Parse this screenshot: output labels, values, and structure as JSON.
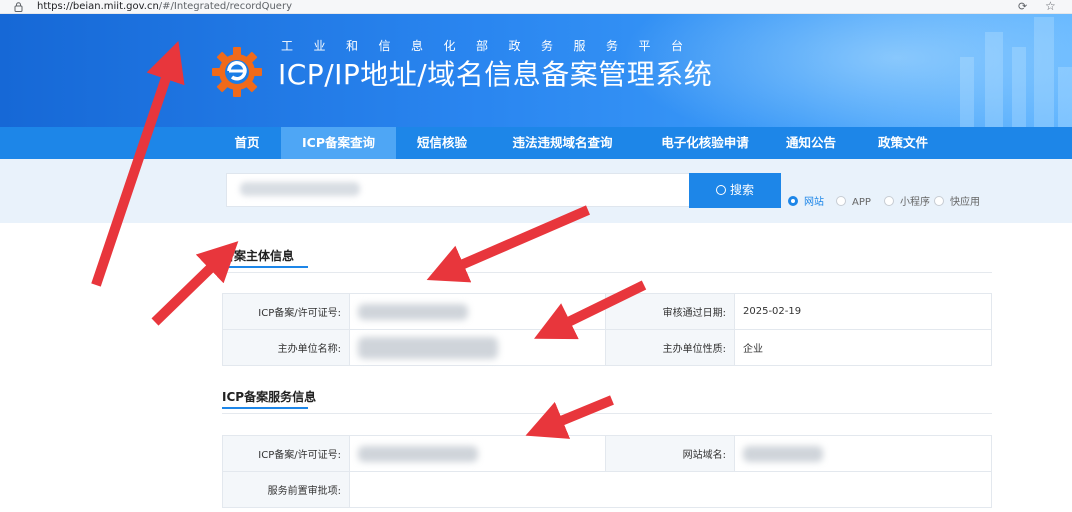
{
  "browser": {
    "url_host": "https://beian.miit.gov.cn",
    "url_path": "/#/Integrated/recordQuery"
  },
  "header": {
    "subtitle": "工业和信息化部政务服务平台",
    "title": "ICP/IP地址/域名信息备案管理系统"
  },
  "nav": {
    "items": [
      {
        "label": "首页"
      },
      {
        "label": "ICP备案查询"
      },
      {
        "label": "短信核验"
      },
      {
        "label": "违法违规域名查询"
      },
      {
        "label": "电子化核验申请"
      },
      {
        "label": "通知公告"
      },
      {
        "label": "政策文件"
      }
    ],
    "active_index": 1
  },
  "search": {
    "button_label": "搜索",
    "options": [
      {
        "label": "网站",
        "checked": true
      },
      {
        "label": "APP",
        "checked": false
      },
      {
        "label": "小程序",
        "checked": false
      },
      {
        "label": "快应用",
        "checked": false
      }
    ]
  },
  "subject_section": {
    "title": "备案主体信息",
    "rows": [
      {
        "k1": "ICP备案/许可证号:",
        "k2": "审核通过日期:",
        "v2": "2025-02-19"
      },
      {
        "k1": "主办单位名称:",
        "k2": "主办单位性质:",
        "v2": "企业"
      }
    ]
  },
  "service_section": {
    "title": "ICP备案服务信息",
    "rows": [
      {
        "k1": "ICP备案/许可证号:",
        "k2": "网站域名:"
      },
      {
        "k1": "服务前置审批项:"
      }
    ]
  },
  "colors": {
    "accent": "#1d86e8",
    "arrow": "#e8363c"
  }
}
